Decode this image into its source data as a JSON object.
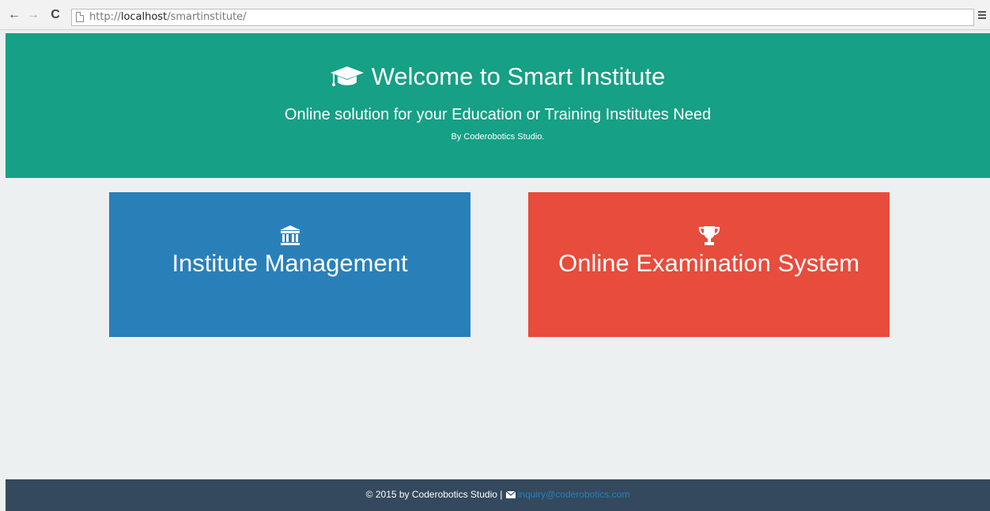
{
  "browser": {
    "url_scheme": "http://",
    "url_host": "localhost",
    "url_path": "/smartinstitute/",
    "back_icon": "←",
    "forward_icon": "→",
    "reload_icon": "C"
  },
  "header": {
    "title": "Welcome to Smart Institute",
    "subtitle": "Online solution for your Education or Training Institutes Need",
    "byline": "By Coderobotics Studio.",
    "icon": "graduation-cap-icon",
    "background": "#16a085"
  },
  "tiles": [
    {
      "label": "Institute Management",
      "icon": "institution-icon",
      "color": "#2980b9"
    },
    {
      "label": "Online Examination System",
      "icon": "trophy-icon",
      "color": "#e74c3c"
    }
  ],
  "footer": {
    "copyright": "© 2015 by Coderobotics Studio | ",
    "email": "inquiry@coderobotics.com",
    "background": "#34495e"
  },
  "page_background": "#ecf0f1"
}
